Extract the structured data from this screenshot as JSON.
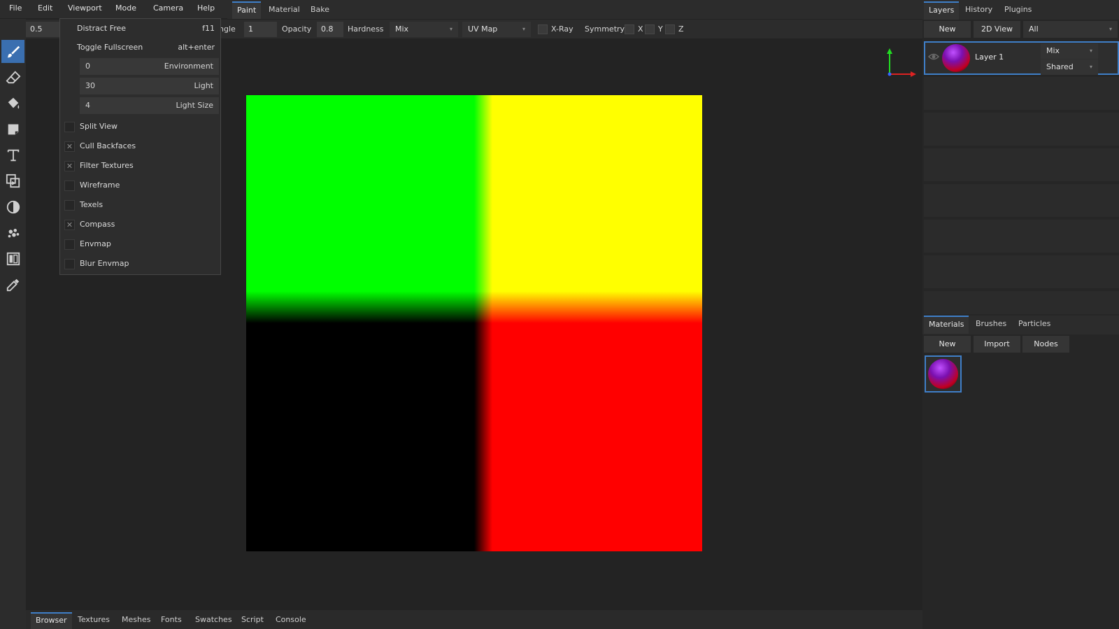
{
  "menubar": {
    "file": "File",
    "edit": "Edit",
    "viewport": "Viewport",
    "mode": "Mode",
    "camera": "Camera",
    "help": "Help"
  },
  "workspace_tabs": {
    "paint": "Paint",
    "material": "Material",
    "bake": "Bake",
    "active": "Paint"
  },
  "toolbar": {
    "radius_value": "0.5",
    "angle_label_partial": "ngle",
    "angle_value": "1",
    "opacity_label": "Opacity",
    "opacity_value": "0.8",
    "hardness_label": "Hardness",
    "blend_mode": "Mix",
    "uv_mode": "UV Map",
    "xray_label": "X-Ray",
    "symmetry_label": "Symmetry",
    "sym_x": "X",
    "sym_y": "Y",
    "sym_z": "Z"
  },
  "left_tools": [
    "brush-icon",
    "eraser-icon",
    "fill-icon",
    "decal-icon",
    "text-icon",
    "clone-icon",
    "blur-icon",
    "particle-icon",
    "bake-icon",
    "picker-icon"
  ],
  "viewport_menu": {
    "distract_free": "Distract Free",
    "distract_free_shortcut": "f11",
    "toggle_fullscreen": "Toggle Fullscreen",
    "toggle_fullscreen_shortcut": "alt+enter",
    "environment_value": "0",
    "environment_label": "Environment",
    "light_value": "30",
    "light_label": "Light",
    "light_size_value": "4",
    "light_size_label": "Light Size",
    "options": [
      {
        "label": "Split View",
        "checked": false
      },
      {
        "label": "Cull Backfaces",
        "checked": true
      },
      {
        "label": "Filter Textures",
        "checked": true
      },
      {
        "label": "Wireframe",
        "checked": false
      },
      {
        "label": "Texels",
        "checked": false
      },
      {
        "label": "Compass",
        "checked": true
      },
      {
        "label": "Envmap",
        "checked": false
      },
      {
        "label": "Blur Envmap",
        "checked": false
      }
    ],
    "check_glyph": "✕"
  },
  "right_panel": {
    "tabs": [
      "Layers",
      "History",
      "Plugins"
    ],
    "new_button": "New",
    "view_button": "2D View",
    "filter": "All",
    "layer": {
      "name": "Layer 1",
      "blend": "Mix",
      "mode": "Shared"
    },
    "lower_tabs": [
      "Materials",
      "Brushes",
      "Particles"
    ],
    "mat_new": "New",
    "mat_import": "Import",
    "mat_nodes": "Nodes"
  },
  "bottom_tabs": [
    "Browser",
    "Textures",
    "Meshes",
    "Fonts",
    "Swatches",
    "Script",
    "Console"
  ],
  "colors": {
    "accent": "#3f7fc8",
    "panel": "#2c2c2c",
    "background": "#232323"
  }
}
